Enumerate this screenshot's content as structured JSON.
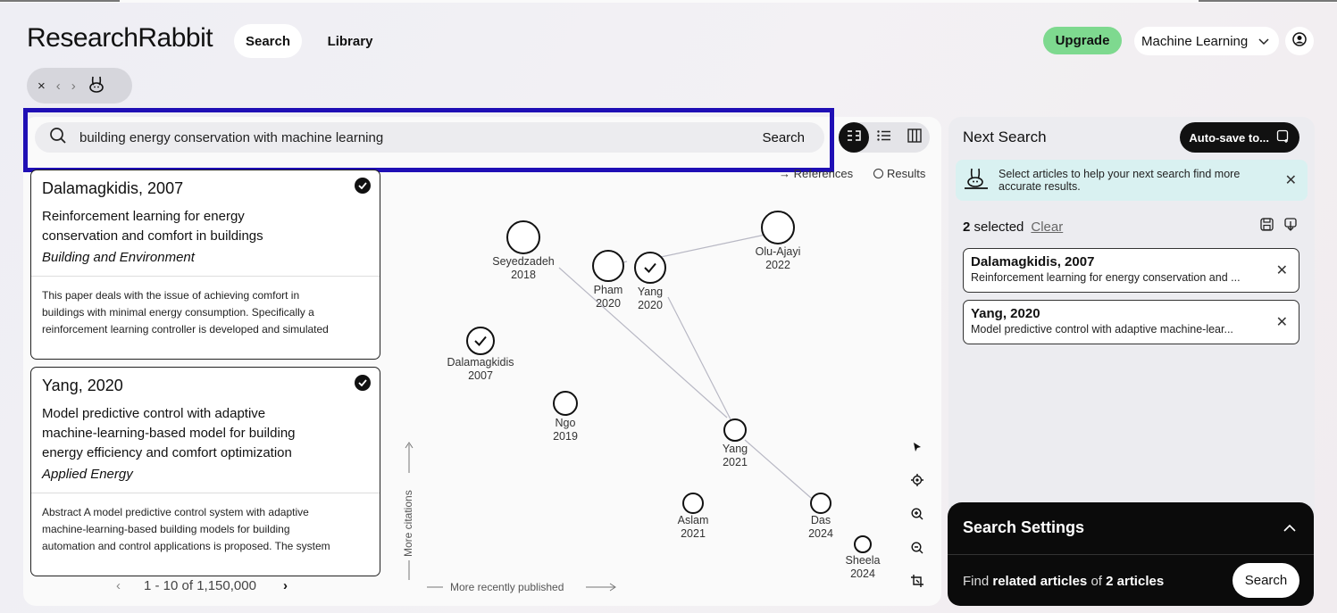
{
  "header": {
    "logo": "ResearchRabbit",
    "nav": {
      "search": "Search",
      "library": "Library"
    },
    "upgrade": "Upgrade",
    "collection": "Machine Learning"
  },
  "history": {
    "close": "×",
    "back": "‹",
    "forward": "›"
  },
  "search": {
    "query": "building energy conservation with machine learning",
    "button": "Search"
  },
  "legend": {
    "references": "→ References",
    "results": "Results"
  },
  "papers": [
    {
      "title": "Dalamagkidis, 2007",
      "subtitle_line1": "Reinforcement learning for energy",
      "subtitle_line2": "conservation and comfort in buildings",
      "venue": "Building and Environment",
      "abstract_line1": "This paper deals with the issue of achieving comfort in",
      "abstract_line2": "buildings with minimal energy consumption. Specifically a",
      "abstract_line3": "reinforcement learning controller is developed and simulated"
    },
    {
      "title": "Yang, 2020",
      "subtitle_line1": "Model predictive control with adaptive",
      "subtitle_line2": "machine-learning-based model for building",
      "subtitle_line3": "energy efficiency and comfort optimization",
      "venue": "Applied Energy",
      "abstract_line1": "Abstract A model predictive control system with adaptive",
      "abstract_line2": "machine-learning-based building models for building",
      "abstract_line3": "automation and control applications is proposed. The system"
    }
  ],
  "pager": {
    "prev": "‹",
    "range": "1 - 10 of 1,150,000",
    "next": "›"
  },
  "graph": {
    "y_axis": "More citations",
    "x_axis": "More recently published",
    "nodes": [
      {
        "name": "Seyedzadeh",
        "year": "2018",
        "selected": false
      },
      {
        "name": "Olu-Ajayi",
        "year": "2022",
        "selected": false
      },
      {
        "name": "Pham",
        "year": "2020",
        "selected": false
      },
      {
        "name": "Yang",
        "year": "2020",
        "selected": true
      },
      {
        "name": "Dalamagkidis",
        "year": "2007",
        "selected": true
      },
      {
        "name": "Ngo",
        "year": "2019",
        "selected": false
      },
      {
        "name": "Yang",
        "year": "2021",
        "selected": false
      },
      {
        "name": "Aslam",
        "year": "2021",
        "selected": false
      },
      {
        "name": "Das",
        "year": "2024",
        "selected": false
      },
      {
        "name": "Sheela",
        "year": "2024",
        "selected": false
      }
    ]
  },
  "next_search": {
    "title": "Next Search",
    "autosave": "Auto-save to...",
    "hint": "Select articles to help your next search find more accurate results.",
    "selected_count": "2",
    "selected_label": "selected",
    "clear": "Clear",
    "selected": [
      {
        "title": "Dalamagkidis, 2007",
        "subtitle": "Reinforcement learning for energy conservation and ..."
      },
      {
        "title": "Yang, 2020",
        "subtitle": "Model predictive control with adaptive machine-lear..."
      }
    ]
  },
  "settings": {
    "title": "Search Settings",
    "find_prefix": "Find",
    "find_bold1": "related articles",
    "find_mid": "of",
    "find_bold2": "2 articles",
    "button": "Search"
  },
  "colors": {
    "accent_green": "#7ed98f",
    "highlight_border": "#1f0fb5",
    "hint_bg": "#d9f1f1"
  }
}
